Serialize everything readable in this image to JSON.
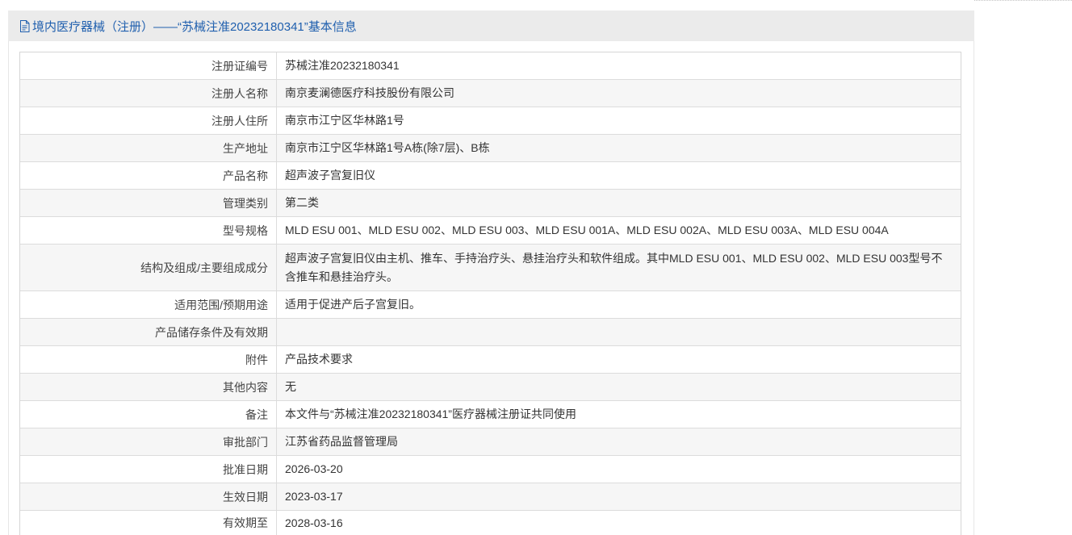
{
  "header": {
    "icon": "document-icon",
    "title": "境内医疗器械（注册）——“苏械注准20232180341”基本信息"
  },
  "colors": {
    "title_text": "#1f5fae",
    "header_background": "#ebebeb",
    "alt_row_background": "#f6f6f6",
    "border": "#dcdcdc"
  },
  "fields": [
    {
      "label": "注册证编号",
      "value": "苏械注准20232180341"
    },
    {
      "label": "注册人名称",
      "value": "南京麦澜德医疗科技股份有限公司"
    },
    {
      "label": "注册人住所",
      "value": "南京市江宁区华林路1号"
    },
    {
      "label": "生产地址",
      "value": "南京市江宁区华林路1号A栋(除7层)、B栋"
    },
    {
      "label": "产品名称",
      "value": "超声波子宫复旧仪"
    },
    {
      "label": "管理类别",
      "value": "第二类"
    },
    {
      "label": "型号规格",
      "value": "MLD ESU 001、MLD ESU 002、MLD ESU 003、MLD ESU 001A、MLD ESU 002A、MLD ESU 003A、MLD ESU 004A"
    },
    {
      "label": "结构及组成/主要组成成分",
      "value": "超声波子宫复旧仪由主机、推车、手持治疗头、悬挂治疗头和软件组成。其中MLD ESU 001、MLD ESU 002、MLD ESU 003型号不含推车和悬挂治疗头。"
    },
    {
      "label": "适用范围/预期用途",
      "value": "适用于促进产后子宫复旧。"
    },
    {
      "label": "产品储存条件及有效期",
      "value": ""
    },
    {
      "label": "附件",
      "value": "产品技术要求"
    },
    {
      "label": "其他内容",
      "value": "无"
    },
    {
      "label": "备注",
      "value": "本文件与“苏械注准20232180341”医疗器械注册证共同使用"
    },
    {
      "label": "审批部门",
      "value": "江苏省药品监督管理局"
    },
    {
      "label": "批准日期",
      "value": "2026-03-20"
    },
    {
      "label": "生效日期",
      "value": "2023-03-17"
    },
    {
      "label": "有效期至",
      "value": "2028-03-16"
    }
  ]
}
